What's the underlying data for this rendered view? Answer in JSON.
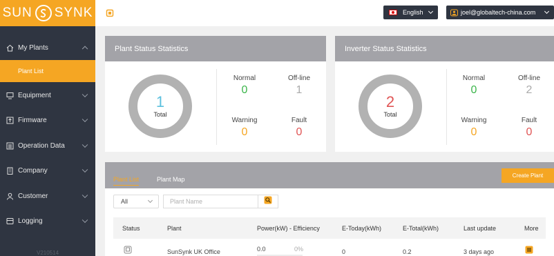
{
  "brand": {
    "left": "SUN",
    "right": "SYNK"
  },
  "sidebar": {
    "items": [
      {
        "label": "My Plants",
        "icon": "home-icon"
      },
      {
        "label": "Equipment",
        "icon": "monitor-icon"
      },
      {
        "label": "Firmware",
        "icon": "upload-icon"
      },
      {
        "label": "Operation Data",
        "icon": "list-icon"
      },
      {
        "label": "Company",
        "icon": "building-icon"
      },
      {
        "label": "Customer",
        "icon": "user-icon"
      },
      {
        "label": "Logging",
        "icon": "log-icon"
      }
    ],
    "sub_item": "Plant List",
    "version": "V210514"
  },
  "topbar": {
    "language": "English",
    "user": "joel@globaltech-china.com"
  },
  "plant_status": {
    "title": "Plant Status Statistics",
    "total": "1",
    "total_label": "Total",
    "normal_label": "Normal",
    "normal": "0",
    "offline_label": "Off-line",
    "offline": "1",
    "warning_label": "Warning",
    "warning": "0",
    "fault_label": "Fault",
    "fault": "0"
  },
  "inverter_status": {
    "title": "Inverter Status Statistics",
    "total": "2",
    "total_label": "Total",
    "normal_label": "Normal",
    "normal": "0",
    "offline_label": "Off-line",
    "offline": "2",
    "warning_label": "Warning",
    "warning": "0",
    "fault_label": "Fault",
    "fault": "0"
  },
  "plant_panel": {
    "tabs": [
      "Plant List",
      "Plant Map"
    ],
    "create_label": "Create Plant",
    "filter_value": "All",
    "search_placeholder": "Plant Name",
    "columns": [
      "Status",
      "Plant",
      "Power(kW) - Efficiency",
      "E-Today(kWh)",
      "E-Total(kWh)",
      "Last update",
      "More"
    ],
    "rows": [
      {
        "plant": "SunSynk UK Office",
        "power": "0.0",
        "efficiency": "0%",
        "e_today": "0",
        "e_total": "0.2",
        "last_update": "3 days ago"
      }
    ]
  },
  "colors": {
    "accent": "#f5a623",
    "sidebar": "#2f3541",
    "header_gray": "#a3a3a8",
    "normal_green": "#3bb54a",
    "offline_gray": "#aaaaaa",
    "warning_orange": "#f5a623",
    "fault_red": "#e05555",
    "plant_total_blue": "#5bc0de",
    "inverter_total_red": "#e05555"
  }
}
